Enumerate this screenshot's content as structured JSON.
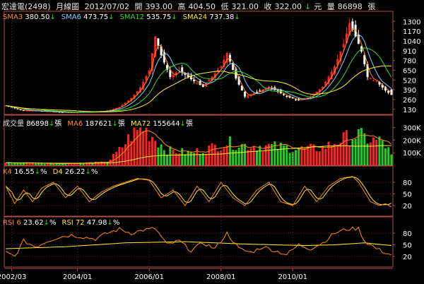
{
  "header": {
    "stock_name": "宏達電(2498)",
    "period": "月線圖",
    "date": "2012/07/02",
    "open_label": "開",
    "open": "393.00",
    "high_label": "高",
    "high": "404.50",
    "low_label": "低",
    "low": "321.00",
    "close_label": "收",
    "close": "322.00",
    "close_arrow": "↓",
    "unit_yuan": "元",
    "volume_label": "量",
    "volume": "86898",
    "unit_lots": "張"
  },
  "legends": {
    "price": [
      {
        "label": "SMA3",
        "value": "380.50",
        "arrow": "↓",
        "color": "#ff8c1a"
      },
      {
        "label": "SMA6",
        "value": "473.75",
        "arrow": "↓",
        "color": "#7fd4ff"
      },
      {
        "label": "SMA12",
        "value": "535.75",
        "arrow": "↓",
        "color": "#33dd33"
      },
      {
        "label": "SMA24",
        "value": "737.38",
        "arrow": "↓",
        "color": "#ffee33"
      }
    ],
    "volume": [
      {
        "label": "成交量",
        "value": "86898",
        "arrow": "↓",
        "unit": "張",
        "color": "#dddddd"
      },
      {
        "label": "MA6",
        "value": "187621",
        "arrow": "↓",
        "unit": "張",
        "color": "#ff8c1a"
      },
      {
        "label": "MA72",
        "value": "155644",
        "arrow": "↓",
        "unit": "張",
        "color": "#ffee33"
      }
    ],
    "kd": [
      {
        "label": "K4",
        "value": "16.55",
        "arrow": "↓",
        "unit": "%",
        "color": "#ff8c1a"
      },
      {
        "label": "D4",
        "value": "26.22",
        "arrow": "↓",
        "unit": "%",
        "color": "#ffee33"
      }
    ],
    "rsi": [
      {
        "label": "RSI 6",
        "value": "23.62",
        "arrow": "↓",
        "unit": "%",
        "color": "#ff8c1a"
      },
      {
        "label": "RSI 72",
        "value": "47.98",
        "arrow": "↓",
        "unit": "%",
        "color": "#ffee33"
      }
    ]
  },
  "colors": {
    "up": "#ff2222",
    "down": "#ffffff",
    "vol_up": "#ff2222",
    "vol_down": "#22cc22",
    "axis": "#b04a4a",
    "grid": "#662222"
  },
  "chart_data": [
    {
      "type": "candlestick",
      "title": "",
      "y_ticks": [
        "1300",
        "1170",
        "1040",
        "910",
        "780",
        "650",
        "520",
        "390",
        "260",
        "130"
      ],
      "ylim": [
        100,
        1340
      ],
      "x_ticks": [
        "2002/03",
        "2004/01",
        "2006/01",
        "2008/01",
        "2010/01"
      ],
      "ohlc_anchors": [
        [
          0,
          180
        ],
        [
          5,
          120
        ],
        [
          10,
          110
        ],
        [
          20,
          90
        ],
        [
          28,
          95
        ],
        [
          34,
          110
        ],
        [
          38,
          160
        ],
        [
          42,
          280
        ],
        [
          45,
          420
        ],
        [
          48,
          650
        ],
        [
          50,
          1100
        ],
        [
          52,
          850
        ],
        [
          55,
          560
        ],
        [
          58,
          650
        ],
        [
          62,
          530
        ],
        [
          66,
          430
        ],
        [
          72,
          700
        ],
        [
          74,
          880
        ],
        [
          77,
          540
        ],
        [
          80,
          300
        ],
        [
          84,
          360
        ],
        [
          88,
          430
        ],
        [
          94,
          300
        ],
        [
          98,
          250
        ],
        [
          102,
          300
        ],
        [
          106,
          430
        ],
        [
          110,
          700
        ],
        [
          113,
          1000
        ],
        [
          115,
          1280
        ],
        [
          117,
          1100
        ],
        [
          119,
          900
        ],
        [
          121,
          560
        ],
        [
          124,
          500
        ],
        [
          127,
          380
        ],
        [
          129,
          322
        ]
      ],
      "series": [
        {
          "name": "SMA3",
          "values_note": "3-month moving average of close"
        },
        {
          "name": "SMA6",
          "values_note": "6-month moving average of close"
        },
        {
          "name": "SMA12",
          "values_note": "12-month moving average of close"
        },
        {
          "name": "SMA24",
          "values_note": "24-month moving average of close"
        }
      ]
    },
    {
      "type": "bar",
      "title": "",
      "y_ticks": [
        "300K",
        "200K",
        "100K"
      ],
      "ylim": [
        0,
        320000
      ],
      "volume_anchors": [
        [
          0,
          20000
        ],
        [
          20,
          15000
        ],
        [
          34,
          25000
        ],
        [
          38,
          120000
        ],
        [
          42,
          240000
        ],
        [
          46,
          300000
        ],
        [
          50,
          210000
        ],
        [
          54,
          120000
        ],
        [
          62,
          100000
        ],
        [
          70,
          150000
        ],
        [
          74,
          180000
        ],
        [
          80,
          160000
        ],
        [
          90,
          150000
        ],
        [
          100,
          130000
        ],
        [
          106,
          140000
        ],
        [
          110,
          180000
        ],
        [
          114,
          220000
        ],
        [
          118,
          240000
        ],
        [
          122,
          200000
        ],
        [
          126,
          190000
        ],
        [
          129,
          86898
        ]
      ]
    },
    {
      "type": "line",
      "title": "",
      "y_ticks": [
        "80",
        "50",
        "20"
      ],
      "ylim": [
        0,
        100
      ],
      "K_anchors": [
        [
          0,
          70
        ],
        [
          3,
          25
        ],
        [
          6,
          60
        ],
        [
          9,
          30
        ],
        [
          12,
          65
        ],
        [
          16,
          80
        ],
        [
          20,
          40
        ],
        [
          24,
          70
        ],
        [
          28,
          30
        ],
        [
          32,
          55
        ],
        [
          36,
          70
        ],
        [
          40,
          80
        ],
        [
          44,
          90
        ],
        [
          48,
          85
        ],
        [
          52,
          40
        ],
        [
          56,
          60
        ],
        [
          60,
          20
        ],
        [
          64,
          70
        ],
        [
          68,
          30
        ],
        [
          72,
          80
        ],
        [
          76,
          40
        ],
        [
          80,
          20
        ],
        [
          84,
          60
        ],
        [
          88,
          80
        ],
        [
          92,
          30
        ],
        [
          96,
          20
        ],
        [
          100,
          70
        ],
        [
          104,
          30
        ],
        [
          108,
          70
        ],
        [
          112,
          90
        ],
        [
          116,
          95
        ],
        [
          118,
          80
        ],
        [
          122,
          30
        ],
        [
          125,
          20
        ],
        [
          127,
          25
        ],
        [
          129,
          16.55
        ]
      ]
    },
    {
      "type": "line",
      "title": "",
      "y_ticks": [
        "80",
        "50",
        "20"
      ],
      "ylim": [
        0,
        100
      ],
      "RSI6_anchors": [
        [
          0,
          30
        ],
        [
          3,
          20
        ],
        [
          6,
          60
        ],
        [
          10,
          45
        ],
        [
          14,
          60
        ],
        [
          18,
          70
        ],
        [
          22,
          75
        ],
        [
          26,
          70
        ],
        [
          30,
          65
        ],
        [
          34,
          80
        ],
        [
          38,
          90
        ],
        [
          42,
          80
        ],
        [
          46,
          88
        ],
        [
          50,
          92
        ],
        [
          54,
          50
        ],
        [
          58,
          60
        ],
        [
          62,
          35
        ],
        [
          66,
          55
        ],
        [
          70,
          40
        ],
        [
          74,
          80
        ],
        [
          78,
          40
        ],
        [
          82,
          30
        ],
        [
          86,
          45
        ],
        [
          90,
          35
        ],
        [
          94,
          25
        ],
        [
          98,
          50
        ],
        [
          102,
          40
        ],
        [
          106,
          55
        ],
        [
          110,
          80
        ],
        [
          114,
          90
        ],
        [
          118,
          92
        ],
        [
          120,
          60
        ],
        [
          124,
          40
        ],
        [
          127,
          30
        ],
        [
          129,
          23.62
        ]
      ],
      "RSI72_anchors": [
        [
          0,
          40
        ],
        [
          20,
          45
        ],
        [
          40,
          55
        ],
        [
          60,
          58
        ],
        [
          80,
          52
        ],
        [
          100,
          48
        ],
        [
          110,
          50
        ],
        [
          120,
          55
        ],
        [
          129,
          47.98
        ]
      ]
    }
  ]
}
